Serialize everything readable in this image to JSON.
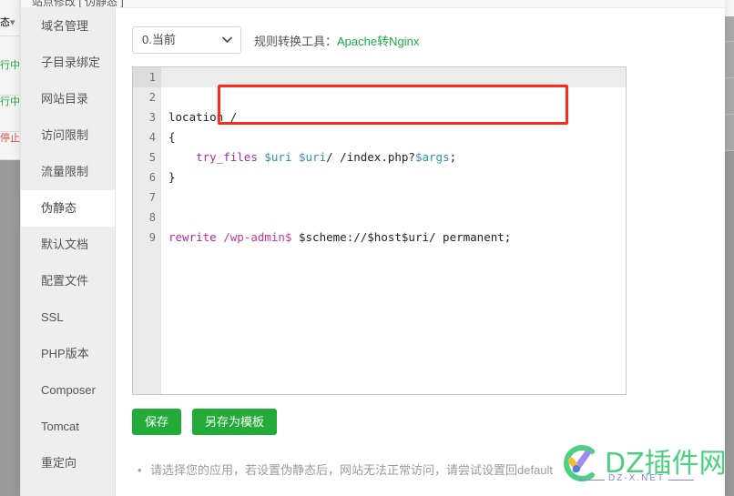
{
  "window": {
    "header_text": "站点修改  [ 伪静态 ]"
  },
  "background": {
    "rows": [
      {
        "text": "态",
        "caret": "▾",
        "kind": "header"
      },
      {
        "text": "行中",
        "kind": "running"
      },
      {
        "text": "行中",
        "kind": "running"
      },
      {
        "text": "停止",
        "kind": "stopped"
      }
    ]
  },
  "sidebar": {
    "items": [
      {
        "label": "域名管理",
        "active": false
      },
      {
        "label": "子目录绑定",
        "active": false
      },
      {
        "label": "网站目录",
        "active": false
      },
      {
        "label": "访问限制",
        "active": false
      },
      {
        "label": "流量限制",
        "active": false
      },
      {
        "label": "伪静态",
        "active": true
      },
      {
        "label": "默认文档",
        "active": false
      },
      {
        "label": "配置文件",
        "active": false
      },
      {
        "label": "SSL",
        "active": false
      },
      {
        "label": "PHP版本",
        "active": false
      },
      {
        "label": "Composer",
        "active": false
      },
      {
        "label": "Tomcat",
        "active": false
      },
      {
        "label": "重定向",
        "active": false
      }
    ]
  },
  "toolbar": {
    "select_value": "0.当前",
    "select_caret": "⌄",
    "converter_label": "规则转换工具：",
    "converter_link": "Apache转Nginx"
  },
  "editor": {
    "lines": [
      {
        "num": "1",
        "active": true,
        "tokens": []
      },
      {
        "num": "2",
        "active": false,
        "tokens": []
      },
      {
        "num": "3",
        "active": false,
        "tokens": [
          {
            "t": "location /",
            "c": "tk-plain"
          }
        ]
      },
      {
        "num": "4",
        "active": false,
        "tokens": [
          {
            "t": "{",
            "c": "tk-plain"
          }
        ]
      },
      {
        "num": "5",
        "active": false,
        "tokens": [
          {
            "t": "    ",
            "c": "tk-plain"
          },
          {
            "t": "try_files",
            "c": "tk-fn"
          },
          {
            "t": " ",
            "c": "tk-plain"
          },
          {
            "t": "$uri",
            "c": "tk-var"
          },
          {
            "t": " ",
            "c": "tk-plain"
          },
          {
            "t": "$uri",
            "c": "tk-var"
          },
          {
            "t": "/ /index.php?",
            "c": "tk-plain"
          },
          {
            "t": "$args",
            "c": "tk-var"
          },
          {
            "t": ";",
            "c": "tk-plain"
          }
        ]
      },
      {
        "num": "6",
        "active": false,
        "tokens": [
          {
            "t": "}",
            "c": "tk-plain"
          }
        ]
      },
      {
        "num": "7",
        "active": false,
        "tokens": []
      },
      {
        "num": "8",
        "active": false,
        "tokens": []
      },
      {
        "num": "9",
        "active": false,
        "tokens": [
          {
            "t": "rewrite",
            "c": "tk-kw"
          },
          {
            "t": " ",
            "c": "tk-plain"
          },
          {
            "t": "/wp-admin$",
            "c": "tk-path"
          },
          {
            "t": " $scheme://$host$uri/ permanent;",
            "c": "tk-plain"
          }
        ]
      }
    ]
  },
  "actions": {
    "save_label": "保存",
    "save_as_template_label": "另存为模板"
  },
  "hints": {
    "items": [
      "请选择您的应用，若设置伪静态后，网站无法正常访问，请尝试设置回default"
    ]
  },
  "watermark": {
    "text": "DZ插件网",
    "sub": "DZ-X.NET"
  },
  "colors": {
    "accent_green": "#22ab38",
    "link_green": "#1aab44",
    "highlight_red": "#fb2b1c",
    "watermark_green": "#4ad17f",
    "watermark_purple": "#8c7fe0"
  }
}
